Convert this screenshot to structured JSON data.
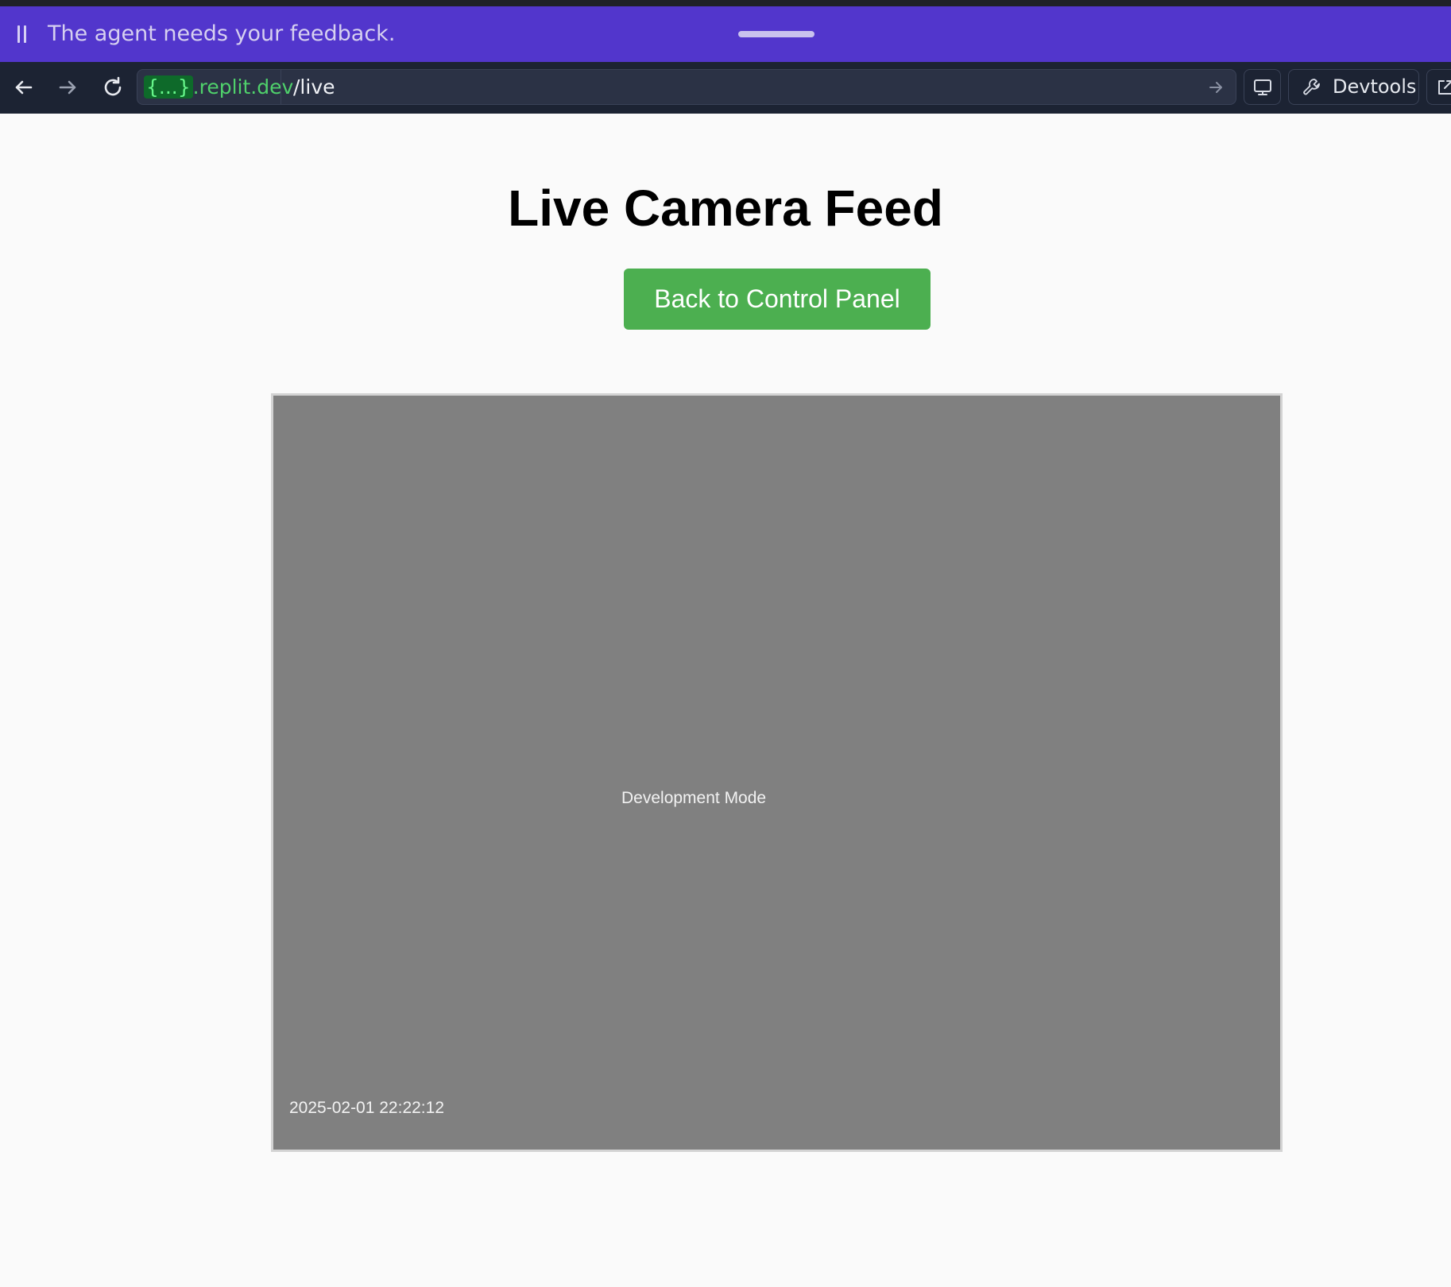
{
  "agent_bar": {
    "message": "The agent needs your feedback.",
    "background_color": "#5236cc"
  },
  "browser": {
    "url_domain_prefix": "{...}",
    "url_domain_suffix": ".replit.dev",
    "url_path": "/live",
    "devtools_label": "Devtools",
    "icons": [
      "back-arrow-icon",
      "forward-arrow-icon",
      "reload-icon",
      "go-arrow-icon",
      "monitor-icon",
      "wrench-icon",
      "open-external-icon"
    ]
  },
  "page": {
    "title": "Live Camera Feed",
    "back_button_label": "Back to Control Panel",
    "button_color": "#4caf50",
    "feed": {
      "mode_text": "Development Mode",
      "timestamp": "2025-02-01 22:22:12",
      "background_color": "#808080"
    }
  }
}
